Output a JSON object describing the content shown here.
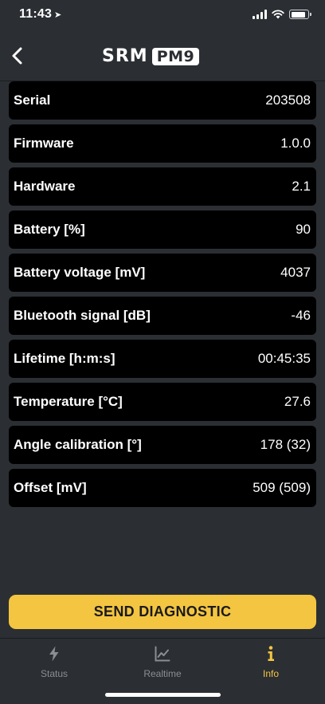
{
  "status_bar": {
    "time": "11:43"
  },
  "header": {
    "logo_brand": "SRM",
    "logo_model": "PM9"
  },
  "info": [
    {
      "label": "Serial",
      "value": "203508"
    },
    {
      "label": "Firmware",
      "value": "1.0.0"
    },
    {
      "label": "Hardware",
      "value": "2.1"
    },
    {
      "label": "Battery [%]",
      "value": "90"
    },
    {
      "label": "Battery voltage [mV]",
      "value": "4037"
    },
    {
      "label": "Bluetooth signal [dB]",
      "value": "-46"
    },
    {
      "label": "Lifetime [h:m:s]",
      "value": "00:45:35"
    },
    {
      "label": "Temperature [°C]",
      "value": "27.6"
    },
    {
      "label": "Angle calibration [°]",
      "value": "178 (32)"
    },
    {
      "label": "Offset [mV]",
      "value": "509 (509)"
    }
  ],
  "actions": {
    "send_diagnostic": "SEND DIAGNOSTIC"
  },
  "tabs": [
    {
      "label": "Status",
      "icon": "lightning-icon"
    },
    {
      "label": "Realtime",
      "icon": "chart-icon"
    },
    {
      "label": "Info",
      "icon": "info-icon",
      "active": true
    }
  ],
  "colors": {
    "background": "#2b2f33",
    "row": "#000000",
    "accent": "#f4c541",
    "tab_inactive": "#8a8e92"
  }
}
